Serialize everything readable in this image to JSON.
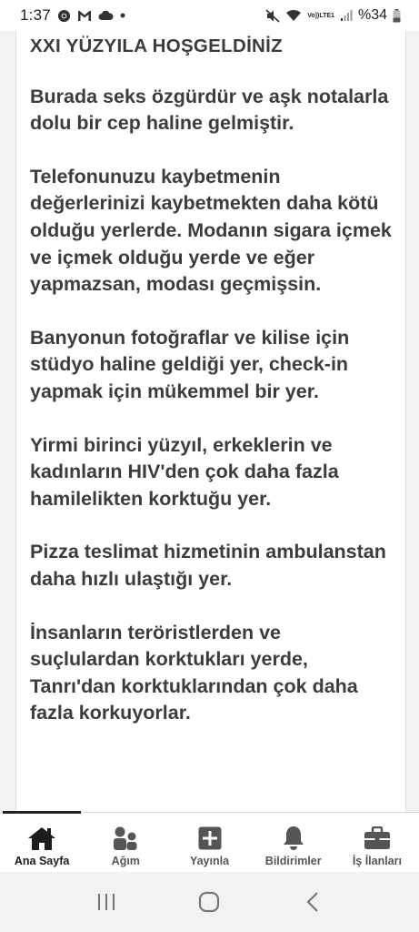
{
  "status_bar": {
    "time": "1:37",
    "left_icons": [
      "chrome-icon",
      "gmail-icon",
      "cloud-icon",
      "dot-icon"
    ],
    "right_icons": [
      "mute-icon",
      "wifi-icon",
      "volte-icon",
      "signal-icon",
      "battery-icon"
    ],
    "volte_line1": "Vo))",
    "volte_line2": "LTE1",
    "battery_percent": "%34"
  },
  "post": {
    "title": "XXI YÜZYILA HOŞGELDİNİZ",
    "paragraphs": [
      "Burada seks özgürdür ve aşk notalarla dolu bir cep haline gelmiştir.",
      "Telefonunuzu kaybetmenin değerlerinizi kaybetmekten daha kötü olduğu yerlerde. Modanın sigara içmek ve içmek olduğu yerde ve eğer yapmazsan, modası geçmişsin.",
      "Banyonun fotoğraflar ve kilise için stüdyo haline geldiği yer, check-in yapmak için mükemmel bir yer.",
      "Yirmi birinci yüzyıl, erkeklerin ve kadınların HIV'den çok daha fazla hamilelikten korktuğu yer.",
      "Pizza teslimat hizmetinin ambulanstan daha hızlı ulaştığı yer.",
      "İnsanların teröristlerden ve suçlulardan korktukları yerde, Tanrı'dan korktuklarından çok daha fazla korkuyorlar."
    ]
  },
  "bottom_nav": {
    "active": "home",
    "items": [
      {
        "id": "home",
        "label": "Ana Sayfa",
        "icon": "home-icon"
      },
      {
        "id": "network",
        "label": "Ağım",
        "icon": "people-icon"
      },
      {
        "id": "post",
        "label": "Yayınla",
        "icon": "add-post-icon"
      },
      {
        "id": "notifications",
        "label": "Bildirimler",
        "icon": "bell-icon"
      },
      {
        "id": "jobs",
        "label": "İş İlanları",
        "icon": "briefcase-icon"
      }
    ]
  },
  "system_nav": {
    "buttons": [
      "recent-apps",
      "home",
      "back"
    ]
  },
  "colors": {
    "text": "#3c3c3c",
    "icon": "#555555",
    "active": "#1c1c1c"
  }
}
